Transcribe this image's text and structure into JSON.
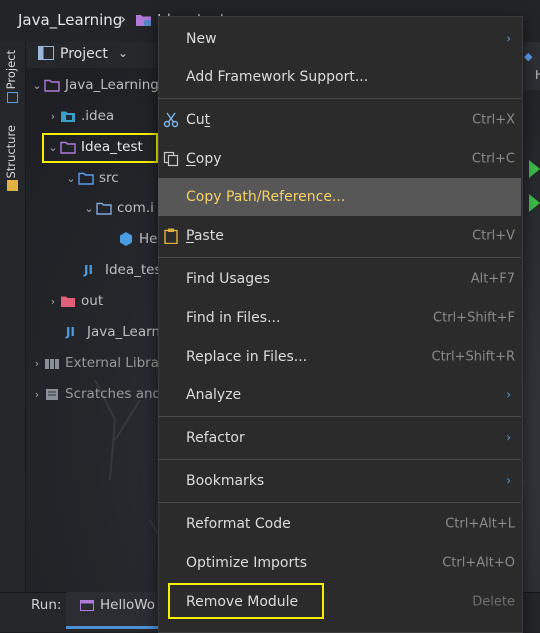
{
  "breadcrumb": {
    "project": "Java_Learning",
    "separator": "›",
    "module": "Idea_test"
  },
  "tool_strip": {
    "project_tab": "Project",
    "structure_tab": "Structure"
  },
  "project_panel": {
    "title": "Project",
    "tree": [
      {
        "label": "Java_Learning",
        "icon": "folder-icon"
      },
      {
        "label": ".idea",
        "icon": "idea-folder-icon"
      },
      {
        "label": "Idea_test",
        "icon": "module-folder-icon"
      },
      {
        "label": "src",
        "icon": "source-folder-icon"
      },
      {
        "label": "com.i",
        "icon": "package-icon"
      },
      {
        "label": "He",
        "icon": "class-icon"
      },
      {
        "label": "Idea_test",
        "icon": "iml-file-icon"
      },
      {
        "label": "out",
        "icon": "excluded-folder-icon"
      },
      {
        "label": "Java_Learni",
        "icon": "iml-file-icon"
      },
      {
        "label": "External Librari",
        "icon": "libraries-icon"
      },
      {
        "label": "Scratches and",
        "icon": "scratches-icon"
      }
    ]
  },
  "context_menu": {
    "items": [
      {
        "label": "New",
        "submenu": true
      },
      {
        "label": "Add Framework Support..."
      },
      {
        "label": "Cut",
        "mnemonic": "t",
        "shortcut": "Ctrl+X",
        "icon": "scissors-icon"
      },
      {
        "label": "Copy",
        "mnemonic": "C",
        "shortcut": "Ctrl+C",
        "icon": "copy-icon"
      },
      {
        "label": "Copy Path/Reference..."
      },
      {
        "label": "Paste",
        "mnemonic": "P",
        "shortcut": "Ctrl+V",
        "icon": "paste-icon"
      },
      {
        "label": "Find Usages",
        "shortcut": "Alt+F7"
      },
      {
        "label": "Find in Files...",
        "shortcut": "Ctrl+Shift+F"
      },
      {
        "label": "Replace in Files...",
        "shortcut": "Ctrl+Shift+R"
      },
      {
        "label": "Analyze",
        "submenu": true
      },
      {
        "label": "Refactor",
        "submenu": true
      },
      {
        "label": "Bookmarks",
        "submenu": true
      },
      {
        "label": "Reformat Code",
        "shortcut": "Ctrl+Alt+L"
      },
      {
        "label": "Optimize Imports",
        "shortcut": "Ctrl+Alt+O"
      },
      {
        "label": "Remove Module",
        "shortcut": "Delete"
      }
    ],
    "selected": "Copy Path/Reference...",
    "submenu_arrow": "›"
  },
  "run_bar": {
    "label": "Run:",
    "tab": "HelloWo"
  },
  "editor": {
    "tab_fragment": "H"
  },
  "colors": {
    "highlight": "#f5f000",
    "selected_text": "#f4d169",
    "accent_blue": "#4f9be6",
    "run_green": "#3ebd4a"
  }
}
